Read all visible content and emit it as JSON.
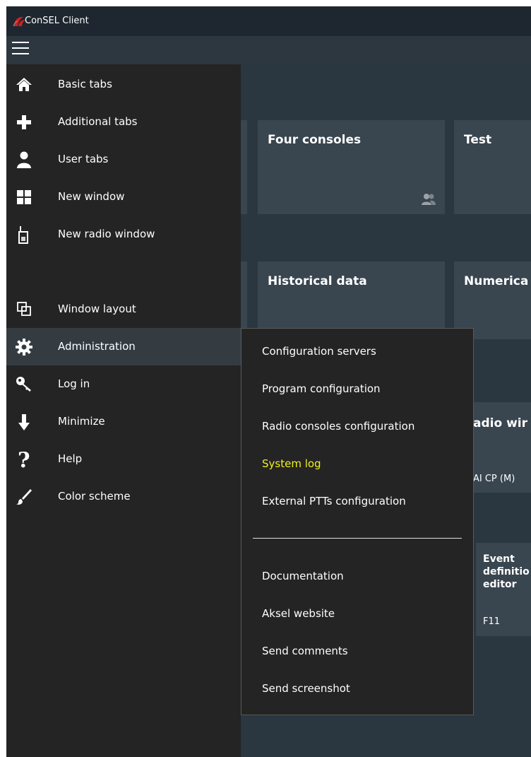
{
  "app": {
    "title": "ConSEL Client"
  },
  "tiles": {
    "four_consoles": "Four consoles",
    "test": "Test",
    "historical_data": "Historical data",
    "numerical": "Numerica",
    "radio_window": "adio wir",
    "radio_window_sub": "AI CP (M)",
    "event_editor": "Event\ndefinitio\neditor",
    "event_editor_key": "F11"
  },
  "sidebar": {
    "items": [
      {
        "label": "Basic tabs",
        "icon": "home-icon"
      },
      {
        "label": "Additional tabs",
        "icon": "plus-icon"
      },
      {
        "label": "User tabs",
        "icon": "user-icon"
      },
      {
        "label": "New window",
        "icon": "windows-grid-icon"
      },
      {
        "label": "New radio window",
        "icon": "radio-handset-icon"
      },
      {
        "label": "Window layout",
        "icon": "window-layout-icon"
      },
      {
        "label": "Administration",
        "icon": "gear-icon"
      },
      {
        "label": "Log in",
        "icon": "key-icon"
      },
      {
        "label": "Minimize",
        "icon": "arrow-down-icon"
      },
      {
        "label": "Help",
        "icon": "question-icon"
      },
      {
        "label": "Color scheme",
        "icon": "brush-icon"
      }
    ]
  },
  "admin_menu": {
    "items": [
      {
        "label": "Configuration servers"
      },
      {
        "label": "Program configuration"
      },
      {
        "label": "Radio consoles configuration"
      },
      {
        "label": "System log"
      },
      {
        "label": "External PTTs configuration"
      }
    ],
    "links": [
      {
        "label": "Documentation"
      },
      {
        "label": "Aksel website"
      },
      {
        "label": "Send comments"
      },
      {
        "label": "Send screenshot"
      }
    ]
  },
  "colors": {
    "sidebar_bg": "#242424",
    "content_bg": "#2a3640",
    "tile_bg": "#39454f",
    "highlight_text": "#f0f020"
  }
}
